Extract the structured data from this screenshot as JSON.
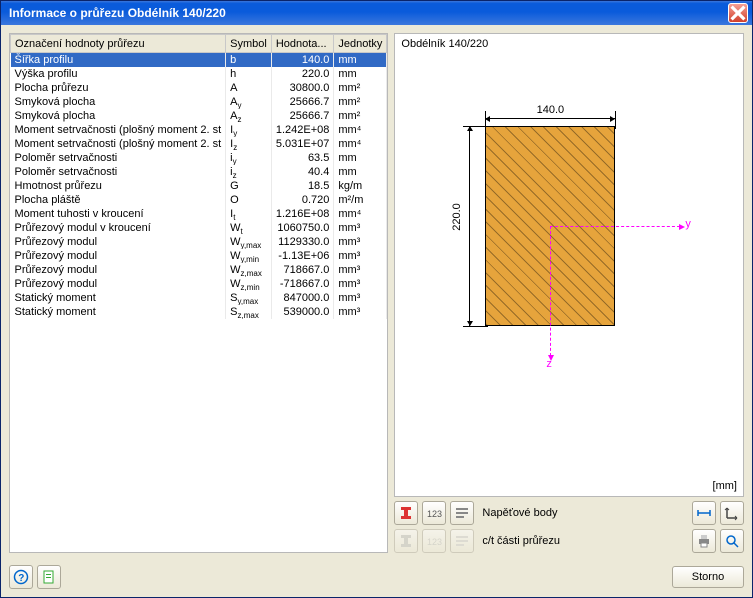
{
  "window": {
    "title": "Informace o průřezu Obdélník 140/220"
  },
  "columns": {
    "label": "Označení hodnoty průřezu",
    "symbol": "Symbol",
    "value": "Hodnota...",
    "units": "Jednotky"
  },
  "rows": [
    {
      "label": "Šířka profilu",
      "sym": "b",
      "val": "140.0",
      "unit": "mm",
      "selected": true
    },
    {
      "label": "Výška profilu",
      "sym": "h",
      "val": "220.0",
      "unit": "mm"
    },
    {
      "label": "Plocha průřezu",
      "sym": "A",
      "val": "30800.0",
      "unit": "mm²"
    },
    {
      "label": "Smyková plocha",
      "sym": "A<sub>y</sub>",
      "val": "25666.7",
      "unit": "mm²"
    },
    {
      "label": "Smyková plocha",
      "sym": "A<sub>z</sub>",
      "val": "25666.7",
      "unit": "mm²"
    },
    {
      "label": "Moment setrvačnosti (plošný moment 2. st",
      "sym": "I<sub>y</sub>",
      "val": "1.242E+08",
      "unit": "mm⁴"
    },
    {
      "label": "Moment setrvačnosti (plošný moment 2. st",
      "sym": "I<sub>z</sub>",
      "val": "5.031E+07",
      "unit": "mm⁴"
    },
    {
      "label": "Poloměr setrvačnosti",
      "sym": "i<sub>y</sub>",
      "val": "63.5",
      "unit": "mm"
    },
    {
      "label": "Poloměr setrvačnosti",
      "sym": "i<sub>z</sub>",
      "val": "40.4",
      "unit": "mm"
    },
    {
      "label": "Hmotnost průřezu",
      "sym": "G",
      "val": "18.5",
      "unit": "kg/m"
    },
    {
      "label": "Plocha pláště",
      "sym": "O",
      "val": "0.720",
      "unit": "m²/m"
    },
    {
      "label": "Moment tuhosti v kroucení",
      "sym": "I<sub>t</sub>",
      "val": "1.216E+08",
      "unit": "mm⁴"
    },
    {
      "label": "Průřezový modul v kroucení",
      "sym": "W<sub>t</sub>",
      "val": "1060750.0",
      "unit": "mm³"
    },
    {
      "label": "Průřezový modul",
      "sym": "W<sub>y,max</sub>",
      "val": "1129330.0",
      "unit": "mm³"
    },
    {
      "label": "Průřezový modul",
      "sym": "W<sub>y,min</sub>",
      "val": "-1.13E+06",
      "unit": "mm³"
    },
    {
      "label": "Průřezový modul",
      "sym": "W<sub>z,max</sub>",
      "val": "718667.0",
      "unit": "mm³"
    },
    {
      "label": "Průřezový modul",
      "sym": "W<sub>z,min</sub>",
      "val": "-718667.0",
      "unit": "mm³"
    },
    {
      "label": "Statický moment",
      "sym": "S<sub>y,max</sub>",
      "val": "847000.0",
      "unit": "mm³"
    },
    {
      "label": "Statický moment",
      "sym": "S<sub>z,max</sub>",
      "val": "539000.0",
      "unit": "mm³"
    }
  ],
  "preview": {
    "title": "Obdélník 140/220",
    "width_label": "140.0",
    "height_label": "220.0",
    "y_axis": "y",
    "z_axis": "z",
    "units": "[mm]"
  },
  "toolbar": {
    "row1_label": "Napěťové body",
    "row2_label": "c/t části průřezu"
  },
  "footer": {
    "storno": "Storno"
  }
}
